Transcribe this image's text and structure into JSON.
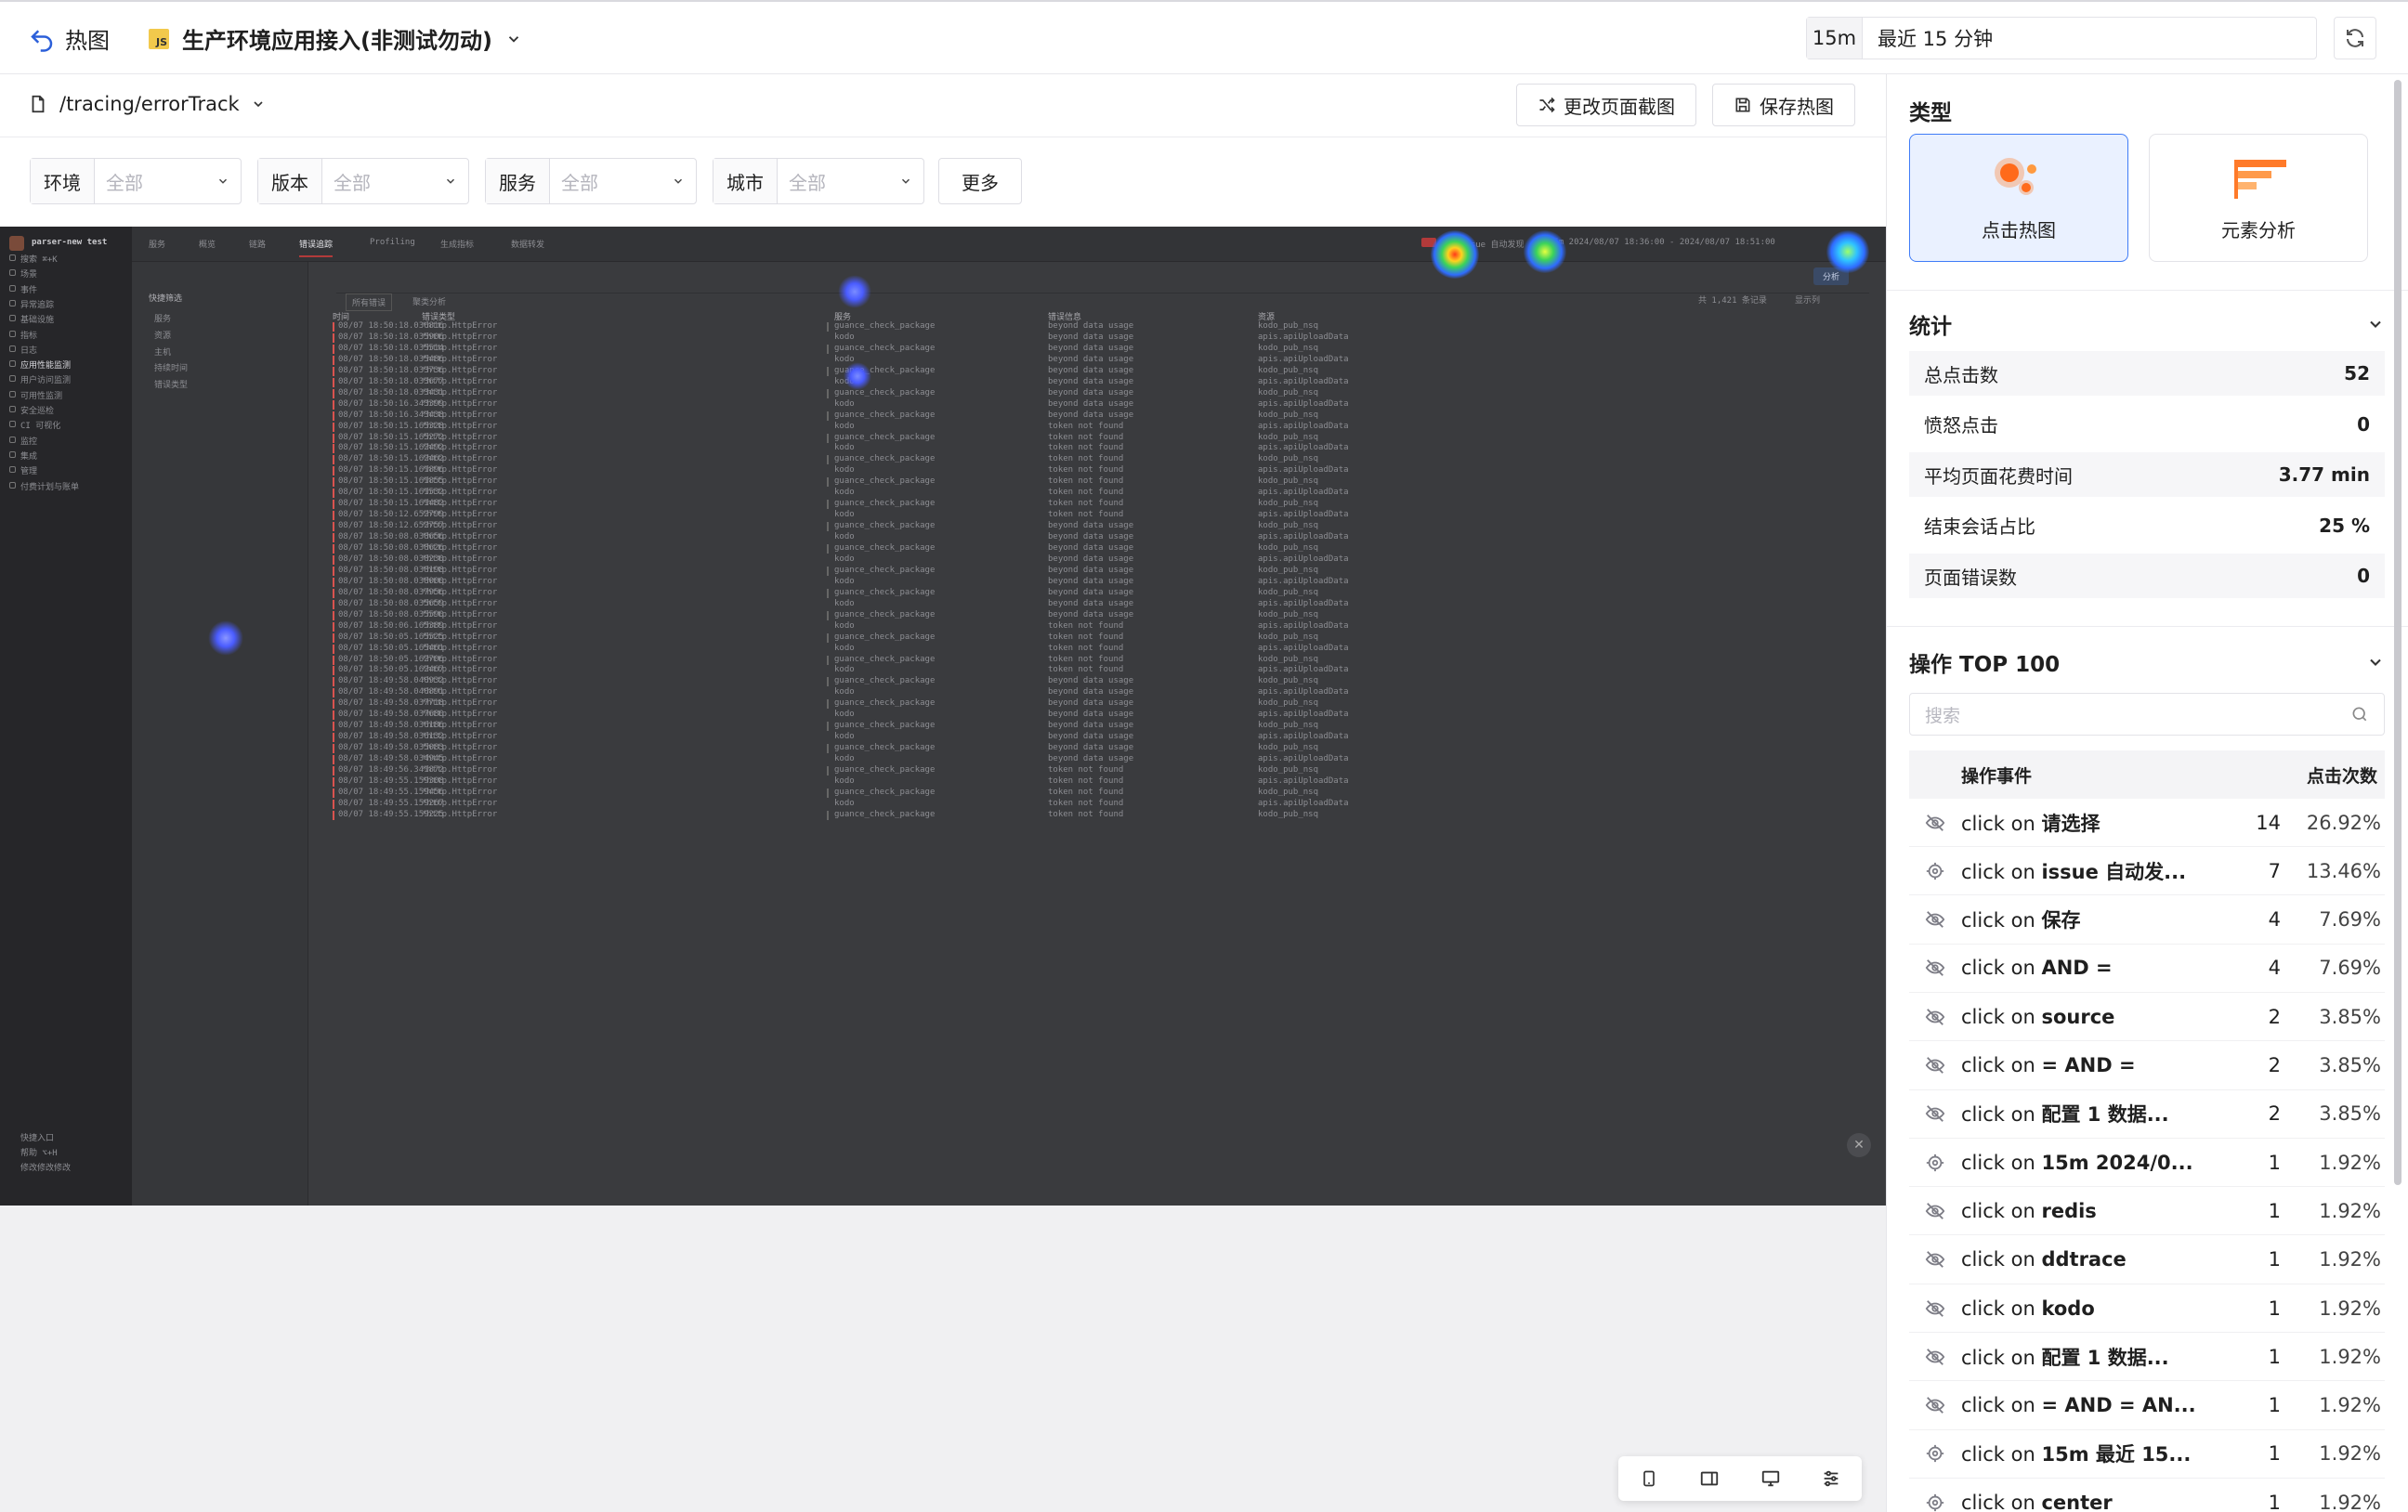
{
  "topbar": {
    "back_label": "热图",
    "app_name": "生产环境应用接入(非测试勿动)",
    "app_badge": "JS",
    "time_tag": "15m",
    "time_text": "最近 15 分钟"
  },
  "page": {
    "path": "/tracing/errorTrack",
    "change_screenshot": "更改页面截图",
    "save_heatmap": "保存热图"
  },
  "filters": [
    {
      "label": "环境",
      "value": "全部"
    },
    {
      "label": "版本",
      "value": "全部"
    },
    {
      "label": "服务",
      "value": "全部"
    },
    {
      "label": "城市",
      "value": "全部"
    }
  ],
  "more_label": "更多",
  "screenshot": {
    "workspace": "parser-new test",
    "nav_tabs": [
      "服务",
      "概览",
      "链路",
      "错误追踪",
      "Profiling",
      "生成指标",
      "数据转发"
    ],
    "side_items": [
      "搜索  ⌘+K",
      "场景",
      "事件",
      "异常追踪",
      "基础设施",
      "指标",
      "日志",
      "应用性能监测",
      "用户访问监测",
      "可用性监测",
      "安全巡检",
      "CI 可视化",
      "监控",
      "集成",
      "管理",
      "付费计划与账单"
    ],
    "side_bottom": [
      "快捷入口",
      "帮助  ⌥+H",
      "修改修改修改"
    ],
    "filter_title": "快捷筛选",
    "filter_items": [
      "服务",
      "资源",
      "主机",
      "持续时间",
      "错误类型"
    ],
    "tab_a": "所有错误",
    "tab_b": "聚类分析",
    "record_count": "共 1,421 条记录",
    "display_cols": "显示列",
    "analyze_btn": "分析",
    "issue_text": "issue 自动发现",
    "range_text": "15m  2024/08/07 18:36:00 - 2024/08/07 18:51:00",
    "columns": [
      "时间",
      "错误类型",
      "服务",
      "错误信息",
      "资源"
    ],
    "timestamps": [
      "08/07 18:50:18.036816",
      "08/07 18:50:18.035906",
      "08/07 18:50:18.035514",
      "08/07 18:50:18.035486",
      "08/07 18:50:18.033736",
      "08/07 18:50:18.033677",
      "08/07 18:50:18.033431",
      "08/07 18:50:16.343399",
      "08/07 18:50:16.343438",
      "08/07 18:50:15.165328",
      "08/07 18:50:15.165272",
      "08/07 18:50:15.162492",
      "08/07 18:50:15.162462",
      "08/07 18:50:15.161896",
      "08/07 18:50:15.161855",
      "08/07 18:50:15.161532",
      "08/07 18:50:15.161482",
      "08/07 18:50:12.652799",
      "08/07 18:50:12.652757",
      "08/07 18:50:08.038656",
      "08/07 18:50:08.038626",
      "08/07 18:50:08.038230",
      "08/07 18:50:08.038198",
      "08/07 18:50:08.038000",
      "08/07 18:50:08.037956",
      "08/07 18:50:08.035659",
      "08/07 18:50:08.035590",
      "08/07 18:50:06.165389",
      "08/07 18:50:05.165525",
      "08/07 18:50:05.165461",
      "08/07 18:50:05.162706",
      "08/07 18:50:05.162467",
      "08/07 18:49:58.040932",
      "08/07 18:49:58.040891",
      "08/07 18:49:58.037718",
      "08/07 18:49:58.037680",
      "08/07 18:49:58.036186",
      "08/07 18:49:58.036132",
      "08/07 18:49:58.035083",
      "08/07 18:49:58.034945",
      "08/07 18:49:56.341872",
      "08/07 18:49:55.159308",
      "08/07 18:49:55.159456",
      "08/07 18:49:55.159267",
      "08/07 18:49:55.159225"
    ],
    "error_type": "*http.HttpError",
    "services": [
      "guance_check_package",
      "kodo"
    ],
    "messages": [
      "beyond data usage",
      "token not found"
    ],
    "resources": [
      "kodo_pub_nsq",
      "apis.apiUploadData"
    ]
  },
  "panel": {
    "type_title": "类型",
    "type_click": "点击热图",
    "type_element": "元素分析",
    "stats_title": "统计",
    "stats": [
      {
        "label": "总点击数",
        "value": "52"
      },
      {
        "label": "愤怒点击",
        "value": "0"
      },
      {
        "label": "平均页面花费时间",
        "value": "3.77 min"
      },
      {
        "label": "结束会话占比",
        "value": "25 %"
      },
      {
        "label": "页面错误数",
        "value": "0"
      }
    ],
    "top_title": "操作 TOP 100",
    "search_placeholder": "搜索",
    "col_event": "操作事件",
    "col_clicks": "点击次数",
    "ops": [
      {
        "icon": "eye-off-icon",
        "target": "请选择",
        "count": "14",
        "pct": "26.92%"
      },
      {
        "icon": "target-icon",
        "target": "issue 自动发...",
        "count": "7",
        "pct": "13.46%"
      },
      {
        "icon": "eye-off-icon",
        "target": "保存",
        "count": "4",
        "pct": "7.69%"
      },
      {
        "icon": "eye-off-icon",
        "target": "AND =",
        "count": "4",
        "pct": "7.69%"
      },
      {
        "icon": "eye-off-icon",
        "target": "source",
        "count": "2",
        "pct": "3.85%"
      },
      {
        "icon": "eye-off-icon",
        "target": "= AND =",
        "count": "2",
        "pct": "3.85%"
      },
      {
        "icon": "eye-off-icon",
        "target": "配置 1 数据...",
        "count": "2",
        "pct": "3.85%"
      },
      {
        "icon": "target-icon",
        "target": "15m 2024/0...",
        "count": "1",
        "pct": "1.92%"
      },
      {
        "icon": "eye-off-icon",
        "target": "redis",
        "count": "1",
        "pct": "1.92%"
      },
      {
        "icon": "eye-off-icon",
        "target": "ddtrace",
        "count": "1",
        "pct": "1.92%"
      },
      {
        "icon": "eye-off-icon",
        "target": "kodo",
        "count": "1",
        "pct": "1.92%"
      },
      {
        "icon": "eye-off-icon",
        "target": "配置 1 数据...",
        "count": "1",
        "pct": "1.92%"
      },
      {
        "icon": "eye-off-icon",
        "target": "= AND = AN...",
        "count": "1",
        "pct": "1.92%"
      },
      {
        "icon": "target-icon",
        "target": "15m 最近 15...",
        "count": "1",
        "pct": "1.92%"
      },
      {
        "icon": "target-icon",
        "target": "center",
        "count": "1",
        "pct": "1.92%"
      }
    ],
    "op_verb": "click",
    "op_prep": "on"
  },
  "colors": {
    "accent": "#3f7cf7",
    "heat_hot": "#ff5a1f",
    "heat_cool": "#5b6cff",
    "error_mark": "#d9534f"
  }
}
